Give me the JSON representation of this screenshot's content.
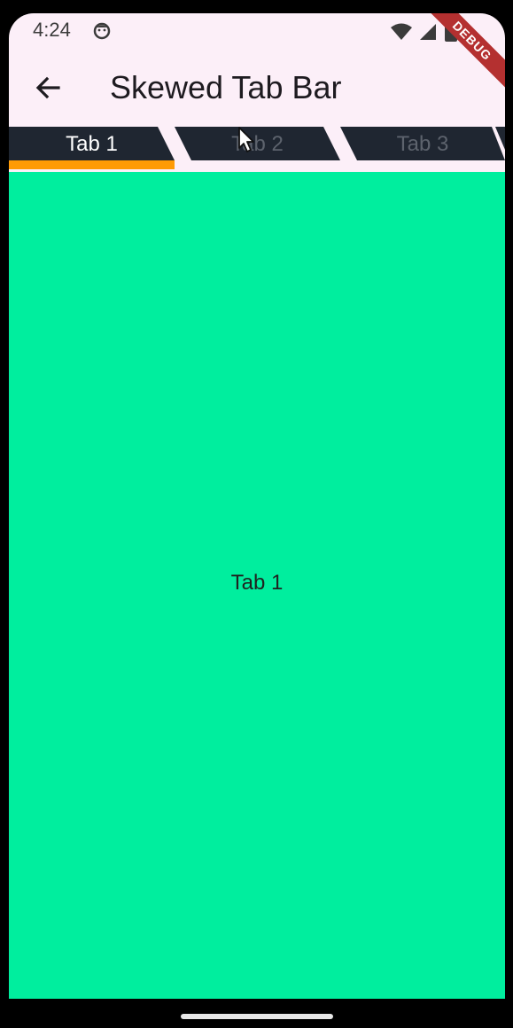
{
  "status_bar": {
    "time": "4:24",
    "debug_label": "DEBUG"
  },
  "app_bar": {
    "title": "Skewed Tab Bar",
    "back_icon": "arrow-back-icon"
  },
  "tabs": [
    {
      "label": "Tab 1",
      "selected": true
    },
    {
      "label": "Tab 2",
      "selected": false
    },
    {
      "label": "Tab 3",
      "selected": false
    }
  ],
  "content": {
    "label": "Tab 1"
  },
  "colors": {
    "background": "#FCEFF8",
    "tab_dark": "#1F2631",
    "indicator": "#FF9B05",
    "content_bg": "#00EE9E",
    "debug_banner": "#B43030"
  }
}
